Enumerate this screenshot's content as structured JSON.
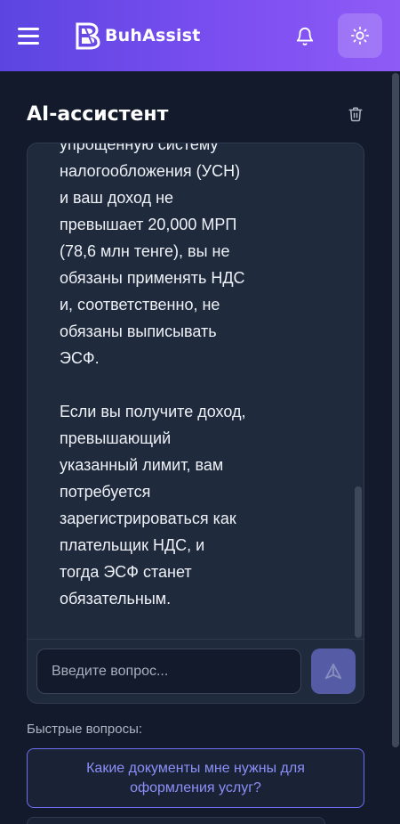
{
  "header": {
    "app_name": "BuhAssist"
  },
  "chat": {
    "title": "AI-ассистент",
    "message": "упрощенную систему\nналогообложения (УСН)\nи ваш доход не\nпревышает 20,000 МРП\n(78,6 млн тенге), вы не\nобязаны применять НДС\nи, соответственно, не\nобязаны выписывать\nЭСФ.\n\nЕсли вы получите доход,\nпревышающий\nуказанный лимит, вам\nпотребуется\nзарегистрироваться как\nплательщик НДС, и\nтогда ЭСФ станет\nобязательным.",
    "input_value": "",
    "input_placeholder": "Введите вопрос..."
  },
  "quick_questions": {
    "label": "Быстрые вопросы:",
    "items": [
      {
        "label": "Какие документы мне нужны для оформления услуг?"
      }
    ]
  },
  "colors": {
    "header_gradient_start": "#5b45e0",
    "header_gradient_end": "#8f5bf6",
    "background": "#121a2b",
    "card": "#1f2a3c",
    "accent": "#6d6ff0"
  },
  "icons": {
    "menu": "hamburger-icon",
    "logo": "buhassist-logo-icon",
    "notifications": "bell-icon",
    "theme": "sun-icon",
    "clear": "trash-icon",
    "send": "send-icon"
  }
}
